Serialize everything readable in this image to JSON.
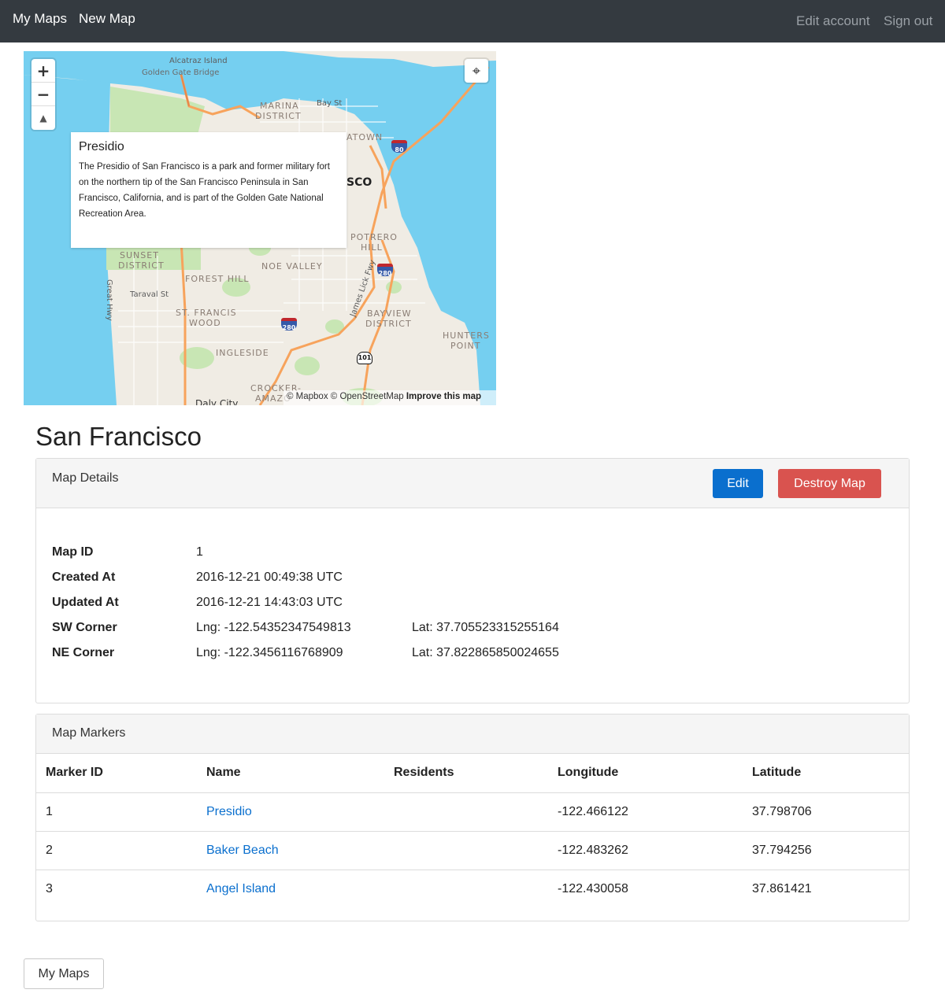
{
  "nav": {
    "my_maps": "My Maps",
    "new_map": "New Map",
    "edit_account": "Edit account",
    "sign_out": "Sign out"
  },
  "map": {
    "zoom_in": "+",
    "zoom_out": "−",
    "compass": "▲",
    "locate": "⌖",
    "labels": {
      "golden_gate": "Golden Gate Bridge",
      "marina": "MARINA",
      "district": "DISTRICT",
      "bay_st": "Bay St",
      "chinatown": "ATOWN",
      "sco": "SCO",
      "potrero": "POTRERO",
      "hill": "HILL",
      "district2": "DISTRICT",
      "sunset": "SUNSET",
      "sunset_district": "DISTRICT",
      "noe_valley": "NOE VALLEY",
      "forest_hill": "FOREST HILL",
      "great_hwy": "Great Hwy",
      "taraval": "Taraval St",
      "st_francis": "ST. FRANCIS",
      "wood": "WOOD",
      "james_lick": "James Lick Fwy",
      "bayview": "BAYVIEW",
      "bayview_district": "DISTRICT",
      "hunters": "HUNTERS",
      "point": "POINT",
      "ingleside": "INGLESIDE",
      "crocker": "CROCKER-",
      "amazon": "AMAZO",
      "daly_city": "Daly City",
      "alcatraz": "Alcatraz Island"
    },
    "shields": {
      "i80": "80",
      "i280a": "280",
      "i280b": "280",
      "us101": "101"
    },
    "popup": {
      "title": "Presidio",
      "body": "The Presidio of San Francisco is a park and former military fort on the northern tip of the San Francisco Peninsula in San Francisco, California, and is part of the Golden Gate National Recreation Area."
    },
    "attribution": {
      "mapbox": "© Mapbox",
      "osm": "© OpenStreetMap",
      "improve": "Improve this map"
    }
  },
  "page_title": "San Francisco",
  "details": {
    "header": "Map Details",
    "edit": "Edit",
    "destroy": "Destroy Map",
    "rows": [
      {
        "label": "Map ID",
        "value": "1",
        "extra": ""
      },
      {
        "label": "Created At",
        "value": "2016-12-21 00:49:38 UTC",
        "extra": ""
      },
      {
        "label": "Updated At",
        "value": "2016-12-21 14:43:03 UTC",
        "extra": ""
      },
      {
        "label": "SW Corner",
        "value": "Lng: -122.54352347549813",
        "extra": "Lat: 37.705523315255164"
      },
      {
        "label": "NE Corner",
        "value": "Lng: -122.3456116768909",
        "extra": "Lat: 37.822865850024655"
      }
    ]
  },
  "markers": {
    "header": "Map Markers",
    "columns": [
      "Marker ID",
      "Name",
      "Residents",
      "Longitude",
      "Latitude"
    ],
    "rows": [
      {
        "id": "1",
        "name": "Presidio",
        "residents": "",
        "lng": "-122.466122",
        "lat": "37.798706"
      },
      {
        "id": "2",
        "name": "Baker Beach",
        "residents": "",
        "lng": "-122.483262",
        "lat": "37.794256"
      },
      {
        "id": "3",
        "name": "Angel Island",
        "residents": "",
        "lng": "-122.430058",
        "lat": "37.861421"
      }
    ]
  },
  "back_button": "My Maps",
  "colors": {
    "navbar": "#343a40",
    "water": "#75cff0",
    "land": "#f0ece4",
    "park": "#c8e6b4",
    "highway": "#f7a35c",
    "primary": "#0a6fce",
    "danger": "#d9534f"
  }
}
